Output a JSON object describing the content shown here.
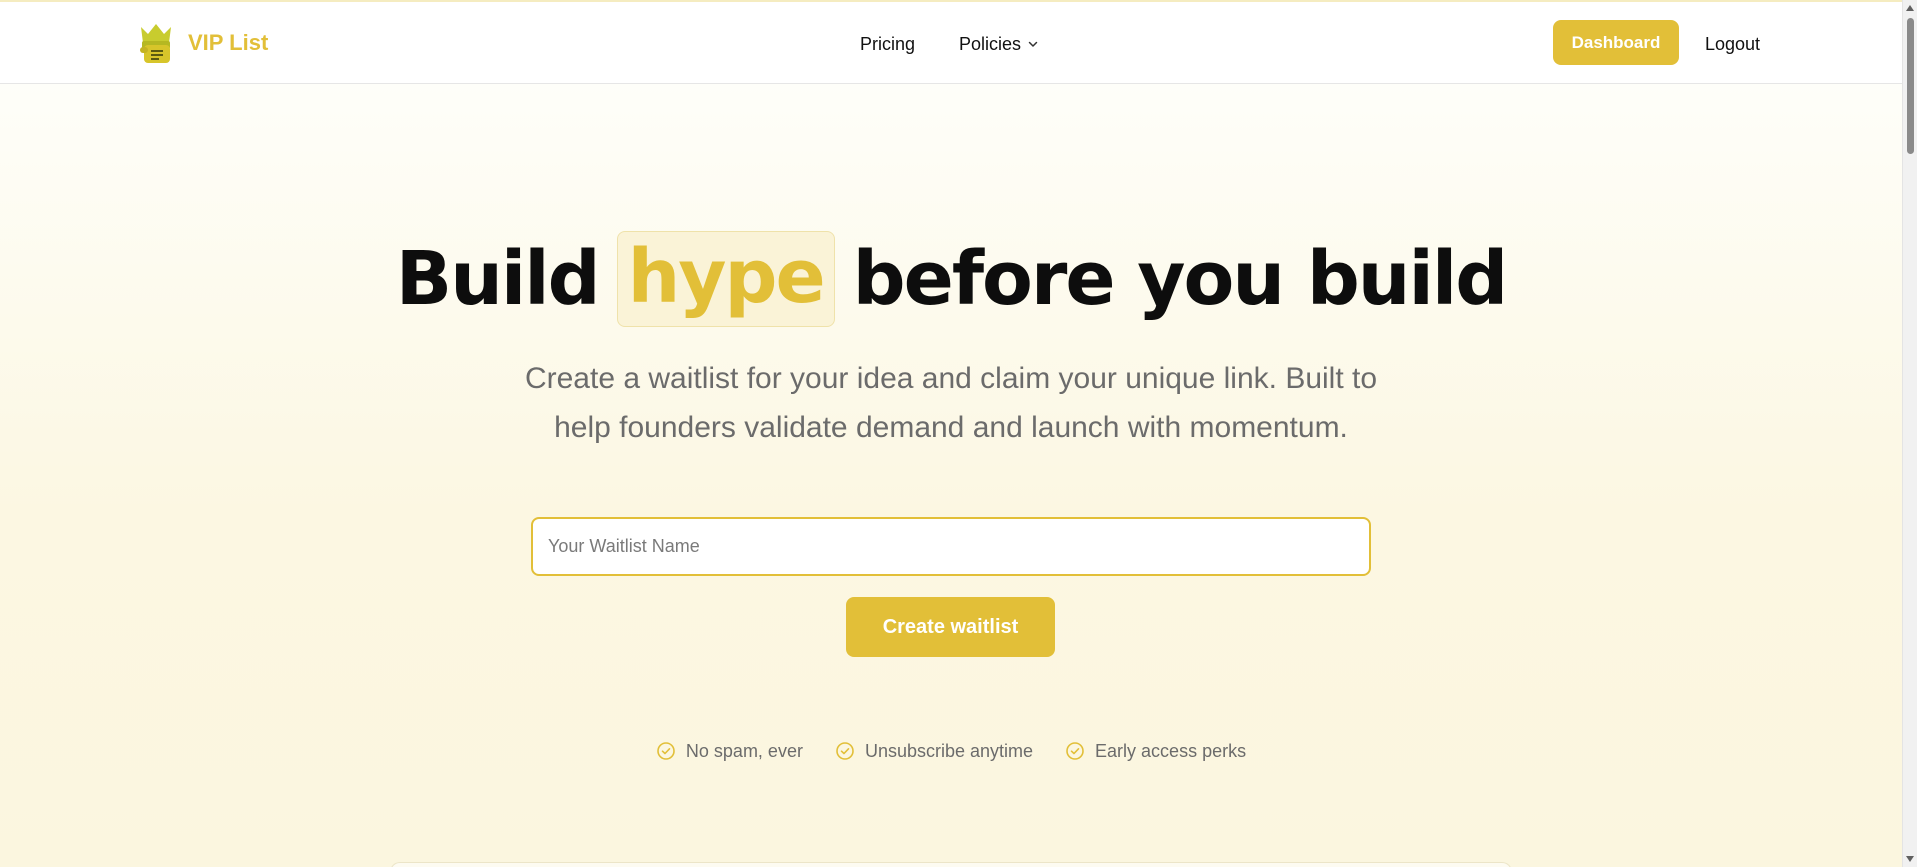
{
  "brand": {
    "name": "VIP List",
    "accent_color": "#e2bf38",
    "logo_icon": "crown-scroll-icon"
  },
  "nav": {
    "links": [
      {
        "label": "Pricing"
      },
      {
        "label": "Policies",
        "icon": "chevron-down-icon"
      }
    ],
    "dashboard_label": "Dashboard",
    "logout_label": "Logout"
  },
  "hero": {
    "headline_before": "Build",
    "headline_highlight": "hype",
    "headline_after": "before you build",
    "subtitle": "Create a waitlist for your idea and claim your unique link. Built to help founders validate demand and launch with momentum.",
    "input_placeholder": "Your Waitlist Name",
    "input_value": "",
    "create_button_label": "Create waitlist"
  },
  "perks": [
    {
      "label": "No spam, ever",
      "icon": "check-circle-icon"
    },
    {
      "label": "Unsubscribe anytime",
      "icon": "check-circle-icon"
    },
    {
      "label": "Early access perks",
      "icon": "check-circle-icon"
    }
  ]
}
